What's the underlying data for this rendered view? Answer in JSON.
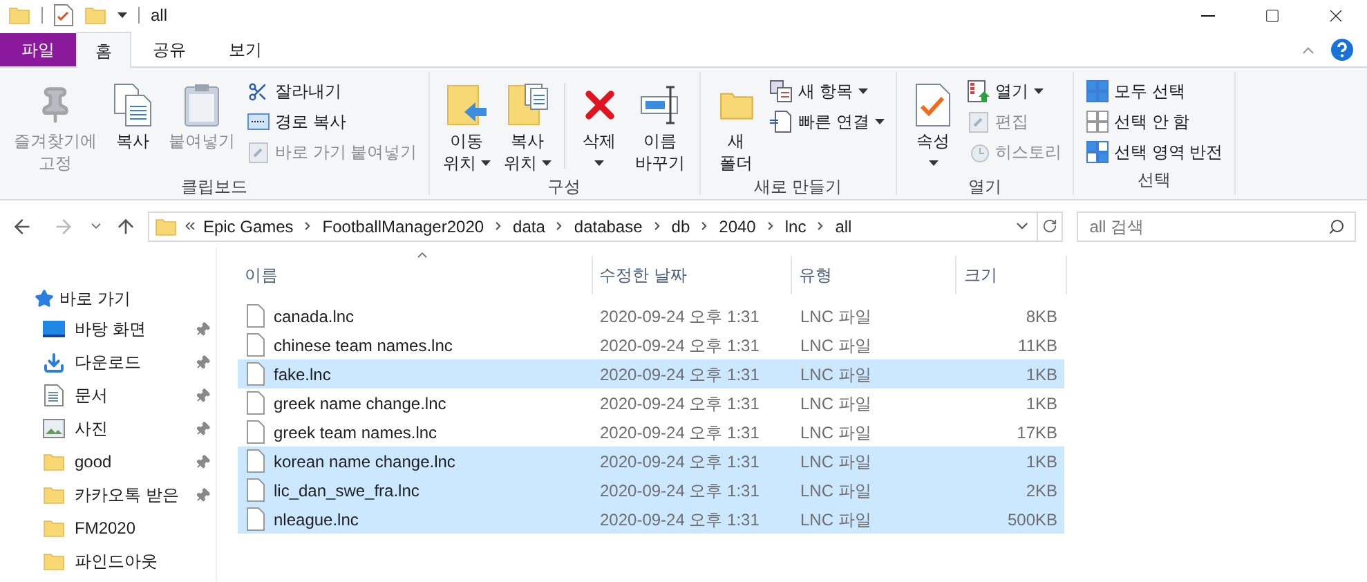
{
  "window": {
    "title": "all"
  },
  "tabs": [
    {
      "label": "파일",
      "kind": "file",
      "selected": false
    },
    {
      "label": "홈",
      "kind": "tab",
      "selected": true
    },
    {
      "label": "공유",
      "kind": "tab",
      "selected": false
    },
    {
      "label": "보기",
      "kind": "tab",
      "selected": false
    }
  ],
  "ribbon": {
    "groups": [
      {
        "label": "클립보드",
        "items": [
          {
            "kind": "large",
            "lines": [
              "즐겨찾기에",
              "고정"
            ],
            "dropdown": false,
            "disabled": true
          },
          {
            "kind": "large",
            "lines": [
              "복사"
            ],
            "dropdown": false,
            "disabled": false
          },
          {
            "kind": "large",
            "lines": [
              "붙여넣기"
            ],
            "dropdown": false,
            "disabled": true
          },
          {
            "kind": "stack",
            "items": [
              {
                "label": "잘라내기",
                "dropdown": false,
                "disabled": false
              },
              {
                "label": "경로 복사",
                "dropdown": false,
                "disabled": false
              },
              {
                "label": "바로 가기 붙여넣기",
                "dropdown": false,
                "disabled": true
              }
            ]
          }
        ]
      },
      {
        "label": "구성",
        "items": [
          {
            "kind": "large",
            "lines": [
              "이동",
              "위치"
            ],
            "dropdown": true,
            "disabled": false
          },
          {
            "kind": "large",
            "lines": [
              "복사",
              "위치"
            ],
            "dropdown": true,
            "disabled": false
          },
          {
            "kind": "separator"
          },
          {
            "kind": "large",
            "lines": [
              "삭제"
            ],
            "dropdown": true,
            "disabled": false
          },
          {
            "kind": "large",
            "lines": [
              "이름",
              "바꾸기"
            ],
            "dropdown": false,
            "disabled": false
          }
        ]
      },
      {
        "label": "새로 만들기",
        "items": [
          {
            "kind": "large",
            "lines": [
              "새",
              "폴더"
            ],
            "dropdown": false,
            "disabled": false
          },
          {
            "kind": "stack",
            "items": [
              {
                "label": "새 항목",
                "dropdown": true,
                "disabled": false
              },
              {
                "label": "빠른 연결",
                "dropdown": true,
                "disabled": false
              }
            ]
          }
        ]
      },
      {
        "label": "열기",
        "items": [
          {
            "kind": "large",
            "lines": [
              "속성"
            ],
            "dropdown": true,
            "disabled": false
          },
          {
            "kind": "stack",
            "items": [
              {
                "label": "열기",
                "dropdown": true,
                "disabled": false
              },
              {
                "label": "편집",
                "dropdown": false,
                "disabled": true
              },
              {
                "label": "히스토리",
                "dropdown": false,
                "disabled": true
              }
            ]
          }
        ]
      },
      {
        "label": "선택",
        "items": [
          {
            "kind": "stack",
            "items": [
              {
                "label": "모두 선택",
                "dropdown": false,
                "disabled": false
              },
              {
                "label": "선택 안 함",
                "dropdown": false,
                "disabled": false
              },
              {
                "label": "선택 영역 반전",
                "dropdown": false,
                "disabled": false
              }
            ]
          }
        ]
      }
    ]
  },
  "address": {
    "crumbs": [
      "Epic Games",
      "FootballManager2020",
      "data",
      "database",
      "db",
      "2040",
      "lnc",
      "all"
    ]
  },
  "search": {
    "placeholder": "all 검색"
  },
  "sidebar": {
    "header": "바로 가기",
    "items": [
      {
        "label": "바탕 화면",
        "kind": "desktop",
        "pinned": true
      },
      {
        "label": "다운로드",
        "kind": "downloads",
        "pinned": true
      },
      {
        "label": "문서",
        "kind": "documents",
        "pinned": true
      },
      {
        "label": "사진",
        "kind": "pictures",
        "pinned": true
      },
      {
        "label": "good",
        "kind": "folder",
        "pinned": true
      },
      {
        "label": "카카오톡 받은",
        "kind": "folder",
        "pinned": true
      },
      {
        "label": "FM2020",
        "kind": "folder",
        "pinned": false
      },
      {
        "label": "파인드아웃",
        "kind": "folder",
        "pinned": false
      }
    ]
  },
  "table": {
    "columns": [
      {
        "label": "이름",
        "sorted": true
      },
      {
        "label": "수정한 날짜",
        "sorted": false
      },
      {
        "label": "유형",
        "sorted": false
      },
      {
        "label": "크기",
        "sorted": false
      }
    ],
    "rows": [
      {
        "name": "canada.lnc",
        "date": "2020-09-24 오후 1:31",
        "type": "LNC 파일",
        "size": "8KB",
        "selected": false
      },
      {
        "name": "chinese team names.lnc",
        "date": "2020-09-24 오후 1:31",
        "type": "LNC 파일",
        "size": "11KB",
        "selected": false
      },
      {
        "name": "fake.lnc",
        "date": "2020-09-24 오후 1:31",
        "type": "LNC 파일",
        "size": "1KB",
        "selected": true
      },
      {
        "name": "greek name change.lnc",
        "date": "2020-09-24 오후 1:31",
        "type": "LNC 파일",
        "size": "1KB",
        "selected": false
      },
      {
        "name": "greek team names.lnc",
        "date": "2020-09-24 오후 1:31",
        "type": "LNC 파일",
        "size": "17KB",
        "selected": false
      },
      {
        "name": "korean name change.lnc",
        "date": "2020-09-24 오후 1:31",
        "type": "LNC 파일",
        "size": "1KB",
        "selected": true
      },
      {
        "name": "lic_dan_swe_fra.lnc",
        "date": "2020-09-24 오후 1:31",
        "type": "LNC 파일",
        "size": "2KB",
        "selected": true
      },
      {
        "name": "nleague.lnc",
        "date": "2020-09-24 오후 1:31",
        "type": "LNC 파일",
        "size": "500KB",
        "selected": true
      }
    ]
  }
}
